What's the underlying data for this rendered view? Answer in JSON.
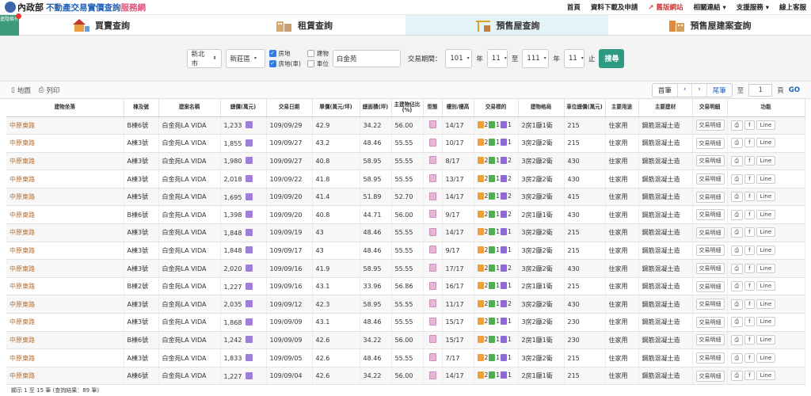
{
  "site": {
    "ministry": "內政部",
    "title": "不動產交易實價查詢",
    "title_suffix": "服務網"
  },
  "topnav": [
    "首頁",
    "資料下載及申請",
    "舊版網站",
    "相關連結",
    "支援服務",
    "線上客服"
  ],
  "advanced_search": "進階條件",
  "tabs": [
    {
      "label": "買賣查詢",
      "active": false
    },
    {
      "label": "租賃查詢",
      "active": false
    },
    {
      "label": "預售屋查詢",
      "active": true
    },
    {
      "label": "預售屋建案查詢",
      "active": false
    }
  ],
  "filter": {
    "city": "新北市",
    "district": "新莊區",
    "types": [
      {
        "label": "房地",
        "checked": true
      },
      {
        "label": "建物",
        "checked": false
      },
      {
        "label": "房地(車)",
        "checked": true
      },
      {
        "label": "車位",
        "checked": false
      }
    ],
    "keyword": "白金苑",
    "period_label": "交易期間：",
    "from_year": "101",
    "from_month": "11",
    "to_label": "至",
    "to_year": "111",
    "to_month": "11",
    "year_label": "年",
    "end_label": "止",
    "search_label": "搜尋"
  },
  "toolbar": {
    "map_label": "地圖",
    "print_label": "列印"
  },
  "pager": {
    "first": "首筆",
    "prev": "‹",
    "next": "›",
    "last": "尾筆",
    "to": "至",
    "page": "1",
    "page_unit": "頁",
    "go": "GO"
  },
  "columns": [
    "建物坐落",
    "棟及號",
    "建案名稱",
    "總價(萬元)",
    "交易日期",
    "單價(萬元/坪)",
    "總面積(坪)",
    "主建物佔比(%)",
    "型態",
    "樓別/樓高",
    "交易標的",
    "建物格局",
    "車位總價(萬元)",
    "主要用途",
    "主要建材",
    "交易明細",
    "功能"
  ],
  "rows": [
    {
      "addr": "中原東路",
      "unit": "B棟6號",
      "project": "白金苑LA VIDA",
      "total": "1,233",
      "date": "109/09/29",
      "price": "42.9",
      "area": "34.22",
      "ratio": "56.00",
      "floor": "14/17",
      "t1": "2",
      "t2": "1",
      "t3": "1",
      "layout": "2房1廳1衛",
      "park": "215",
      "use": "住家用",
      "mat": "鋼筋混凝土造"
    },
    {
      "addr": "中原東路",
      "unit": "A棟3號",
      "project": "白金苑LA VIDA",
      "total": "1,855",
      "date": "109/09/27",
      "price": "43.2",
      "area": "48.46",
      "ratio": "55.55",
      "floor": "10/17",
      "t1": "2",
      "t2": "1",
      "t3": "1",
      "layout": "3房2廳2衛",
      "park": "215",
      "use": "住家用",
      "mat": "鋼筋混凝土造"
    },
    {
      "addr": "中原東路",
      "unit": "A棟3號",
      "project": "白金苑LA VIDA",
      "total": "1,980",
      "date": "109/09/27",
      "price": "40.8",
      "area": "58.95",
      "ratio": "55.55",
      "floor": "8/17",
      "t1": "2",
      "t2": "1",
      "t3": "2",
      "layout": "3房2廳2衛",
      "park": "430",
      "use": "住家用",
      "mat": "鋼筋混凝土造"
    },
    {
      "addr": "中原東路",
      "unit": "A棟3號",
      "project": "白金苑LA VIDA",
      "total": "2,018",
      "date": "109/09/22",
      "price": "41.8",
      "area": "58.95",
      "ratio": "55.55",
      "floor": "13/17",
      "t1": "2",
      "t2": "1",
      "t3": "2",
      "layout": "3房2廳2衛",
      "park": "430",
      "use": "住家用",
      "mat": "鋼筋混凝土造"
    },
    {
      "addr": "中原東路",
      "unit": "A棟5號",
      "project": "白金苑LA VIDA",
      "total": "1,695",
      "date": "109/09/20",
      "price": "41.4",
      "area": "51.89",
      "ratio": "52.70",
      "floor": "14/17",
      "t1": "2",
      "t2": "1",
      "t3": "2",
      "layout": "3房2廳2衛",
      "park": "415",
      "use": "住家用",
      "mat": "鋼筋混凝土造"
    },
    {
      "addr": "中原東路",
      "unit": "B棟6號",
      "project": "白金苑LA VIDA",
      "total": "1,398",
      "date": "109/09/20",
      "price": "40.8",
      "area": "44.71",
      "ratio": "56.00",
      "floor": "9/17",
      "t1": "2",
      "t2": "1",
      "t3": "2",
      "layout": "2房1廳1衛",
      "park": "430",
      "use": "住家用",
      "mat": "鋼筋混凝土造"
    },
    {
      "addr": "中原東路",
      "unit": "A棟3號",
      "project": "白金苑LA VIDA",
      "total": "1,848",
      "date": "109/09/19",
      "price": "43",
      "area": "48.46",
      "ratio": "55.55",
      "floor": "14/17",
      "t1": "2",
      "t2": "1",
      "t3": "1",
      "layout": "3房2廳2衛",
      "park": "215",
      "use": "住家用",
      "mat": "鋼筋混凝土造"
    },
    {
      "addr": "中原東路",
      "unit": "A棟3號",
      "project": "白金苑LA VIDA",
      "total": "1,848",
      "date": "109/09/17",
      "price": "43",
      "area": "48.46",
      "ratio": "55.55",
      "floor": "9/17",
      "t1": "2",
      "t2": "1",
      "t3": "1",
      "layout": "3房2廳2衛",
      "park": "215",
      "use": "住家用",
      "mat": "鋼筋混凝土造"
    },
    {
      "addr": "中原東路",
      "unit": "A棟3號",
      "project": "白金苑LA VIDA",
      "total": "2,020",
      "date": "109/09/16",
      "price": "41.9",
      "area": "58.95",
      "ratio": "55.55",
      "floor": "17/17",
      "t1": "2",
      "t2": "1",
      "t3": "2",
      "layout": "3房2廳2衛",
      "park": "430",
      "use": "住家用",
      "mat": "鋼筋混凝土造"
    },
    {
      "addr": "中原東路",
      "unit": "B棟2號",
      "project": "白金苑LA VIDA",
      "total": "1,227",
      "date": "109/09/16",
      "price": "43.1",
      "area": "33.96",
      "ratio": "56.86",
      "floor": "16/17",
      "t1": "2",
      "t2": "1",
      "t3": "1",
      "layout": "2房1廳1衛",
      "park": "215",
      "use": "住家用",
      "mat": "鋼筋混凝土造"
    },
    {
      "addr": "中原東路",
      "unit": "A棟3號",
      "project": "白金苑LA VIDA",
      "total": "2,035",
      "date": "109/09/12",
      "price": "42.3",
      "area": "58.95",
      "ratio": "55.55",
      "floor": "11/17",
      "t1": "2",
      "t2": "1",
      "t3": "2",
      "layout": "3房2廳2衛",
      "park": "430",
      "use": "住家用",
      "mat": "鋼筋混凝土造"
    },
    {
      "addr": "中原東路",
      "unit": "A棟3號",
      "project": "白金苑LA VIDA",
      "total": "1,868",
      "date": "109/09/09",
      "price": "43.1",
      "area": "48.46",
      "ratio": "55.55",
      "floor": "15/17",
      "t1": "2",
      "t2": "1",
      "t3": "1",
      "layout": "3房2廳2衛",
      "park": "230",
      "use": "住家用",
      "mat": "鋼筋混凝土造"
    },
    {
      "addr": "中原東路",
      "unit": "B棟6號",
      "project": "白金苑LA VIDA",
      "total": "1,242",
      "date": "109/09/09",
      "price": "42.6",
      "area": "34.22",
      "ratio": "56.00",
      "floor": "15/17",
      "t1": "2",
      "t2": "1",
      "t3": "1",
      "layout": "2房1廳1衛",
      "park": "230",
      "use": "住家用",
      "mat": "鋼筋混凝土造"
    },
    {
      "addr": "中原東路",
      "unit": "A棟3號",
      "project": "白金苑LA VIDA",
      "total": "1,833",
      "date": "109/09/05",
      "price": "42.6",
      "area": "48.46",
      "ratio": "55.55",
      "floor": "7/17",
      "t1": "2",
      "t2": "1",
      "t3": "1",
      "layout": "3房2廳2衛",
      "park": "215",
      "use": "住家用",
      "mat": "鋼筋混凝土造"
    },
    {
      "addr": "中原東路",
      "unit": "A棟6號",
      "project": "白金苑LA VIDA",
      "total": "1,227",
      "date": "109/09/04",
      "price": "42.6",
      "area": "34.22",
      "ratio": "56.00",
      "floor": "14/17",
      "t1": "2",
      "t2": "1",
      "t3": "1",
      "layout": "2房1廳1衛",
      "park": "215",
      "use": "住家用",
      "mat": "鋼筋混凝土造"
    }
  ],
  "row_buttons": {
    "detail": "交易明細",
    "fb": "f",
    "line": "Line"
  },
  "footer": "顯示 1 至 15 筆 (查詢結果：89 筆)"
}
